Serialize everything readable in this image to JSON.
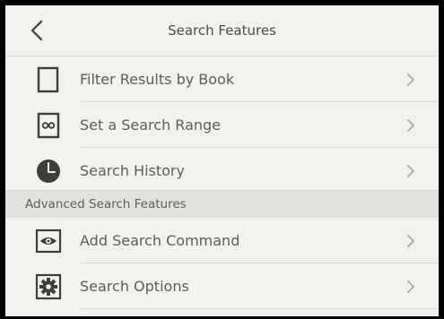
{
  "header": {
    "title": "Search Features",
    "back_icon": "chevron-left-icon"
  },
  "items": [
    {
      "label": "Filter Results by Book",
      "icon": "book-icon"
    },
    {
      "label": "Set a Search Range",
      "icon": "range-icon"
    },
    {
      "label": "Search History",
      "icon": "clock-icon"
    }
  ],
  "section": {
    "label": "Advanced Search Features"
  },
  "advanced_items": [
    {
      "label": "Add Search Command",
      "icon": "eye-icon"
    },
    {
      "label": "Search Options",
      "icon": "gear-icon"
    }
  ],
  "colors": {
    "background": "#f2f1ec",
    "section_background": "#e2e1db",
    "text": "#5e5d59",
    "icon": "#3f3e3b",
    "chevron": "#a9a8a3"
  }
}
